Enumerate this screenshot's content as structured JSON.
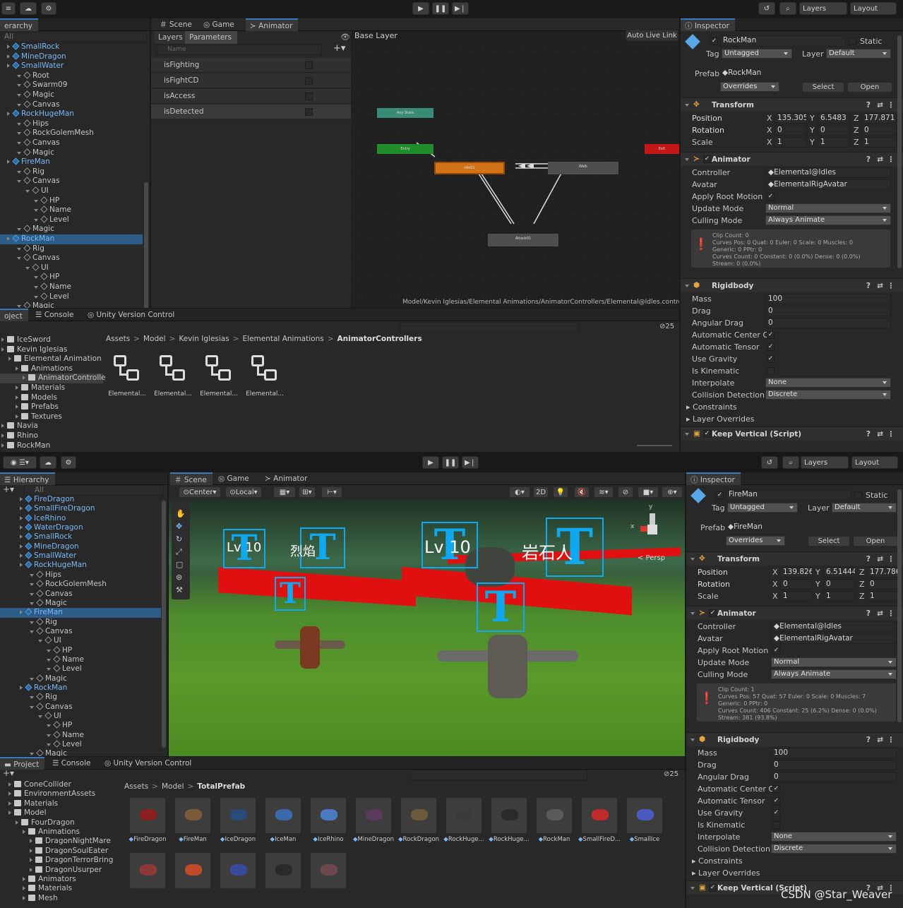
{
  "top": {
    "toolbar": {
      "layers": "Layers",
      "layout": "Layout"
    },
    "hierarchy": {
      "tab": "erarchy",
      "search": "All",
      "rows": [
        {
          "t": "SmallRock",
          "ind": 20,
          "k": "b"
        },
        {
          "t": "MineDragon",
          "ind": 20,
          "k": "b"
        },
        {
          "t": "SmallWater",
          "ind": 20,
          "k": "b"
        },
        {
          "t": "Root",
          "ind": 34,
          "k": "g"
        },
        {
          "t": "Swarm09",
          "ind": 34,
          "k": "g"
        },
        {
          "t": "Magic",
          "ind": 34,
          "k": "g"
        },
        {
          "t": "Canvas",
          "ind": 34,
          "k": "g"
        },
        {
          "t": "RockHugeMan",
          "ind": 20,
          "k": "b"
        },
        {
          "t": "Hips",
          "ind": 34,
          "k": "g"
        },
        {
          "t": "RockGolemMesh",
          "ind": 34,
          "k": "g"
        },
        {
          "t": "Canvas",
          "ind": 34,
          "k": "g"
        },
        {
          "t": "Magic",
          "ind": 34,
          "k": "g"
        },
        {
          "t": "FireMan",
          "ind": 20,
          "k": "b"
        },
        {
          "t": "Rig",
          "ind": 34,
          "k": "g"
        },
        {
          "t": "Canvas",
          "ind": 34,
          "k": "g"
        },
        {
          "t": "UI",
          "ind": 46,
          "k": "g"
        },
        {
          "t": "HP",
          "ind": 58,
          "k": "g"
        },
        {
          "t": "Name",
          "ind": 58,
          "k": "g"
        },
        {
          "t": "Level",
          "ind": 58,
          "k": "g"
        },
        {
          "t": "Magic",
          "ind": 34,
          "k": "g"
        },
        {
          "t": "RockMan",
          "ind": 20,
          "k": "b",
          "sel": true
        },
        {
          "t": "Rig",
          "ind": 34,
          "k": "g"
        },
        {
          "t": "Canvas",
          "ind": 34,
          "k": "g"
        },
        {
          "t": "UI",
          "ind": 46,
          "k": "g"
        },
        {
          "t": "HP",
          "ind": 58,
          "k": "g"
        },
        {
          "t": "Name",
          "ind": 58,
          "k": "g"
        },
        {
          "t": "Level",
          "ind": 58,
          "k": "g"
        },
        {
          "t": "Magic",
          "ind": 34,
          "k": "g"
        }
      ]
    },
    "center_tabs": [
      "Scene",
      "Game",
      "Animator"
    ],
    "animator": {
      "layers_tab": "Layers",
      "params_tab": "Parameters",
      "name_placeholder": "Name",
      "base_layer": "Base Layer",
      "auto_live": "Auto Live Link",
      "params": [
        "isFighting",
        "isFightCD",
        "isAccess",
        "isDetected"
      ],
      "nodes": {
        "any": "Any State",
        "entry": "Entry",
        "exit": "Exit",
        "idle": "idle01",
        "walk": "Walk",
        "attack": "Attack01"
      },
      "path": "Model/Kevin Iglesias/Elemental Animations/AnimatorControllers/Elemental@Idles.controller"
    },
    "bottom_tabs": [
      "oject",
      "Console",
      "Unity Version Control"
    ],
    "project": {
      "count": "25",
      "breadcrumb": [
        "Assets",
        "Model",
        "Kevin Iglesias",
        "Elemental Animations",
        "AnimatorControllers"
      ],
      "tree": [
        "IceSword",
        "Kevin Iglesias",
        "Elemental Animation",
        "Animations",
        "AnimatorControlle",
        "Materials",
        "Models",
        "Prefabs",
        "Textures",
        "Navia",
        "Rhino",
        "RockMan"
      ],
      "items": [
        "Elemental...",
        "Elemental...",
        "Elemental...",
        "Elemental..."
      ]
    },
    "inspector": {
      "tab": "Inspector",
      "name": "RockMan",
      "static": "Static",
      "tag": "Untagged",
      "layer": "Default",
      "prefab": "RockMan",
      "overrides": "Overrides",
      "select": "Select",
      "open": "Open",
      "transform": "Transform",
      "pos": [
        "135.305",
        "6.5483",
        "177.871"
      ],
      "rot": [
        "0",
        "0",
        "0"
      ],
      "scale": [
        "1",
        "1",
        "1"
      ],
      "animator": "Animator",
      "controller": "Elemental@Idles",
      "avatar": "ElementalRigAvatar",
      "update": "Normal",
      "culling": "Always Animate",
      "stats": "Clip Count: 0\nCurves Pos: 0 Quat: 0 Euler: 0 Scale: 0 Muscles: 0\nGeneric: 0 PPtr: 0\nCurves Count: 0 Constant: 0 (0.0%) Dense: 0 (0.0%)\nStream: 0 (0.0%)",
      "rigidbody": "Rigidbody",
      "mass": "100",
      "drag": "0",
      "angular": "0",
      "interp": "None",
      "collision": "Discrete",
      "script": "Keep Vertical (Script)"
    }
  },
  "bottom": {
    "toolbar": {
      "layers": "Layers",
      "layout": "Layout"
    },
    "hierarchy": {
      "tab": "Hierarchy",
      "search": "All",
      "rows": [
        {
          "t": "FireDragon",
          "ind": 38,
          "k": "b"
        },
        {
          "t": "SmallFireDragon",
          "ind": 38,
          "k": "b"
        },
        {
          "t": "IceRhino",
          "ind": 38,
          "k": "b"
        },
        {
          "t": "WaterDragon",
          "ind": 38,
          "k": "b"
        },
        {
          "t": "SmallRock",
          "ind": 38,
          "k": "b"
        },
        {
          "t": "MineDragon",
          "ind": 38,
          "k": "b"
        },
        {
          "t": "SmallWater",
          "ind": 38,
          "k": "b"
        },
        {
          "t": "RockHugeMan",
          "ind": 38,
          "k": "b"
        },
        {
          "t": "Hips",
          "ind": 52,
          "k": "g"
        },
        {
          "t": "RockGolemMesh",
          "ind": 52,
          "k": "g"
        },
        {
          "t": "Canvas",
          "ind": 52,
          "k": "g"
        },
        {
          "t": "Magic",
          "ind": 52,
          "k": "g"
        },
        {
          "t": "FireMan",
          "ind": 38,
          "k": "b",
          "sel": true
        },
        {
          "t": "Rig",
          "ind": 52,
          "k": "g"
        },
        {
          "t": "Canvas",
          "ind": 52,
          "k": "g"
        },
        {
          "t": "UI",
          "ind": 64,
          "k": "g"
        },
        {
          "t": "HP",
          "ind": 76,
          "k": "g"
        },
        {
          "t": "Name",
          "ind": 76,
          "k": "g"
        },
        {
          "t": "Level",
          "ind": 76,
          "k": "g"
        },
        {
          "t": "Magic",
          "ind": 52,
          "k": "g"
        },
        {
          "t": "RockMan",
          "ind": 38,
          "k": "b"
        },
        {
          "t": "Rig",
          "ind": 52,
          "k": "g"
        },
        {
          "t": "Canvas",
          "ind": 52,
          "k": "g"
        },
        {
          "t": "UI",
          "ind": 64,
          "k": "g"
        },
        {
          "t": "HP",
          "ind": 76,
          "k": "g"
        },
        {
          "t": "Name",
          "ind": 76,
          "k": "g"
        },
        {
          "t": "Level",
          "ind": 76,
          "k": "g"
        },
        {
          "t": "Magic",
          "ind": 52,
          "k": "g"
        }
      ]
    },
    "center_tabs": [
      "Scene",
      "Game",
      "Animator"
    ],
    "scene": {
      "center": "Center",
      "local": "Local",
      "mode2d": "2D",
      "persp": "< Persp",
      "axis_y": "y",
      "axis_x": "x",
      "labels": {
        "lv1": "Lv 10",
        "fire": "烈焰",
        "lv2": "Lv 10",
        "rock": "岩石人"
      }
    },
    "bottom_tabs": [
      "Project",
      "Console",
      "Unity Version Control"
    ],
    "project": {
      "count": "25",
      "breadcrumb": [
        "Assets",
        "Model",
        "TotalPrefab"
      ],
      "tree": [
        "ConeCollider",
        "EnvironmentAssets",
        "Materials",
        "Model",
        "FourDragon",
        "Animations",
        "DragonNightMare",
        "DragonSoulEater",
        "DragonTerrorBring",
        "DragonUsurper",
        "Animators",
        "Materials",
        "Mesh"
      ],
      "items": [
        "FireDragon",
        "FireMan",
        "IceDragon",
        "IceMan",
        "IceRhino",
        "MineDragon",
        "RockDragon",
        "RockHuge...",
        "RockHuge...",
        "RockMan",
        "SmallFireD...",
        "SmallIce"
      ]
    },
    "inspector": {
      "tab": "Inspector",
      "name": "FireMan",
      "static": "Static",
      "tag": "Untagged",
      "layer": "Default",
      "prefab": "FireMan",
      "overrides": "Overrides",
      "select": "Select",
      "open": "Open",
      "transform": "Transform",
      "pos": [
        "139.826",
        "6.51444",
        "177.786"
      ],
      "rot": [
        "0",
        "0",
        "0"
      ],
      "scale": [
        "1",
        "1",
        "1"
      ],
      "animator": "Animator",
      "controller": "Elemental@Idles",
      "avatar": "ElementalRigAvatar",
      "update": "Normal",
      "culling": "Always Animate",
      "stats": "Clip Count: 1\nCurves Pos: 57 Quat: 57 Euler: 0 Scale: 0 Muscles: 7\nGeneric: 0 PPtr: 0\nCurves Count: 406 Constant: 25 (6.2%) Dense: 0 (0.0%)\nStream: 381 (93.8%)",
      "rigidbody": "Rigidbody",
      "mass": "100",
      "drag": "0",
      "angular": "0",
      "interp": "None",
      "collision": "Discrete",
      "script": "Keep Vertical (Script)"
    }
  },
  "labels": {
    "tag": "Tag",
    "layer": "Layer",
    "prefab": "Prefab",
    "position": "Position",
    "rotation": "Rotation",
    "scale": "Scale",
    "x": "X",
    "y": "Y",
    "z": "Z",
    "controller": "Controller",
    "avatar": "Avatar",
    "apply_root": "Apply Root Motion",
    "update_mode": "Update Mode",
    "culling_mode": "Culling Mode",
    "mass": "Mass",
    "drag": "Drag",
    "angular": "Angular Drag",
    "auto_com": "Automatic Center Of",
    "auto_tensor": "Automatic Tensor",
    "gravity": "Use Gravity",
    "kinematic": "Is Kinematic",
    "interpolate": "Interpolate",
    "collision": "Collision Detection",
    "constraints": "Constraints",
    "layer_overrides": "Layer Overrides"
  },
  "watermark": "CSDN @Star_Weaver"
}
